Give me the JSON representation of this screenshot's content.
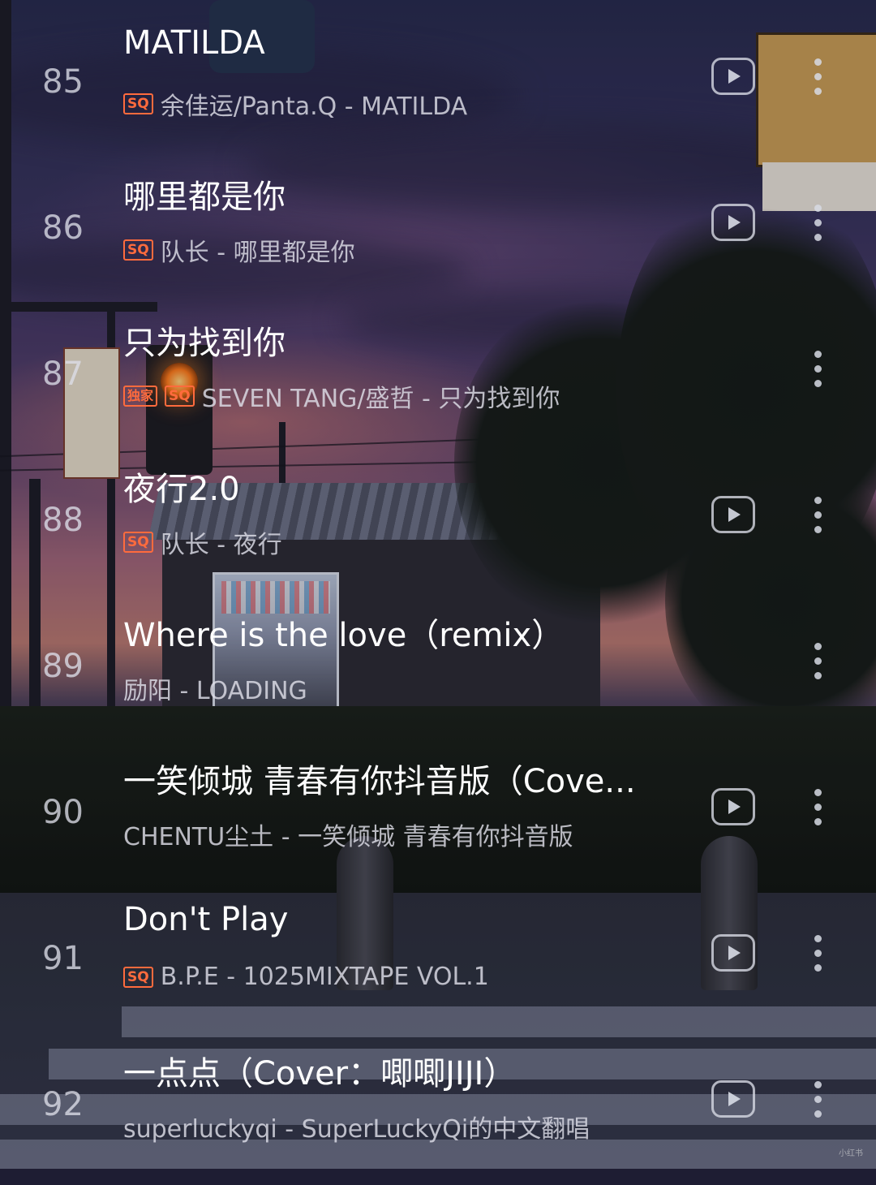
{
  "songs": [
    {
      "number": "85",
      "title": "MATILDA",
      "badges": [
        "SQ"
      ],
      "subtitle": "余佳运/Panta.Q - MATILDA"
    },
    {
      "number": "86",
      "title": "哪里都是你",
      "badges": [
        "SQ"
      ],
      "subtitle": "队长 - 哪里都是你"
    },
    {
      "number": "87",
      "title": "只为找到你",
      "badges": [
        "独家",
        "SQ"
      ],
      "subtitle": "SEVEN TANG/盛哲 - 只为找到你"
    },
    {
      "number": "88",
      "title": "夜行2.0",
      "badges": [
        "SQ"
      ],
      "subtitle": "队长 - 夜行"
    },
    {
      "number": "89",
      "title": "Where is the love（remix）",
      "badges": [],
      "subtitle": "励阳 - LOADING"
    },
    {
      "number": "90",
      "title": "一笑倾城 青春有你抖音版（Cove...",
      "badges": [],
      "subtitle": "CHENTU尘土 - 一笑倾城 青春有你抖音版"
    },
    {
      "number": "91",
      "title": "Don't Play",
      "badges": [
        "SQ"
      ],
      "subtitle": "B.P.E - 1025MIXTAPE VOL.1"
    },
    {
      "number": "92",
      "title": "一点点（Cover：唧唧JIJI）",
      "badges": [],
      "subtitle": "superluckyqi - SuperLuckyQi的中文翻唱"
    }
  ],
  "icons": {
    "play": "play-icon",
    "more": "more-vertical-icon"
  },
  "colors": {
    "badge": "#ff6b3d",
    "text": "#ffffff",
    "subtext": "#dedee8"
  },
  "watermark": "小红书"
}
